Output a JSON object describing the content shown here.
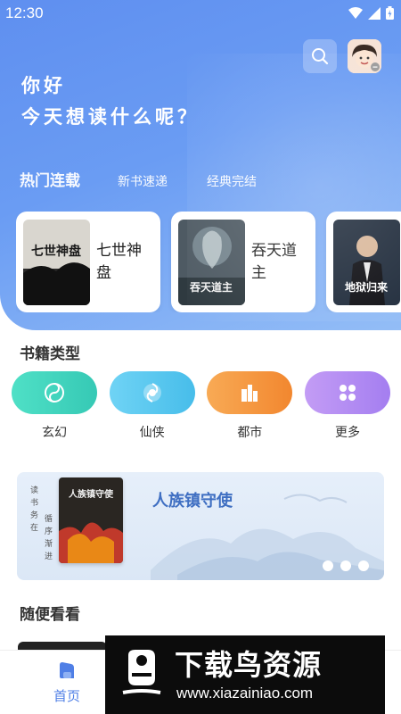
{
  "status_bar": {
    "time": "12:30"
  },
  "greeting": {
    "line1": "你好",
    "line2": "今天想读什么呢？"
  },
  "tabs": [
    {
      "label": "热门连载",
      "active": true
    },
    {
      "label": "新书速递",
      "active": false
    },
    {
      "label": "经典完结",
      "active": false
    }
  ],
  "hot_books": [
    {
      "title": "七世神盘",
      "cover_text": "七世神盘"
    },
    {
      "title": "吞天道主",
      "cover_text": "吞天道主"
    },
    {
      "title": "",
      "cover_text": "地狱归来"
    }
  ],
  "categories_section": {
    "title": "书籍类型",
    "items": [
      {
        "label": "玄幻",
        "color": "#3fd6c0",
        "icon": "yinyang-icon"
      },
      {
        "label": "仙侠",
        "color": "#5cc8f0",
        "icon": "swirl-icon"
      },
      {
        "label": "都市",
        "color": "#f59a3f",
        "icon": "building-icon"
      },
      {
        "label": "更多",
        "color": "#b48cf2",
        "icon": "grid-icon"
      }
    ]
  },
  "banner": {
    "vertical_text_1": "读书务在",
    "vertical_text_2": "循序渐进",
    "book_title": "人族镇守使",
    "cover_text": "人族镇守使"
  },
  "random_section": {
    "title": "随便看看"
  },
  "bottom_nav": {
    "home_label": "首页",
    "accent": "#4f7fe6"
  },
  "watermark": {
    "name": "下载鸟资源",
    "url": "www.xiazainiao.com"
  }
}
